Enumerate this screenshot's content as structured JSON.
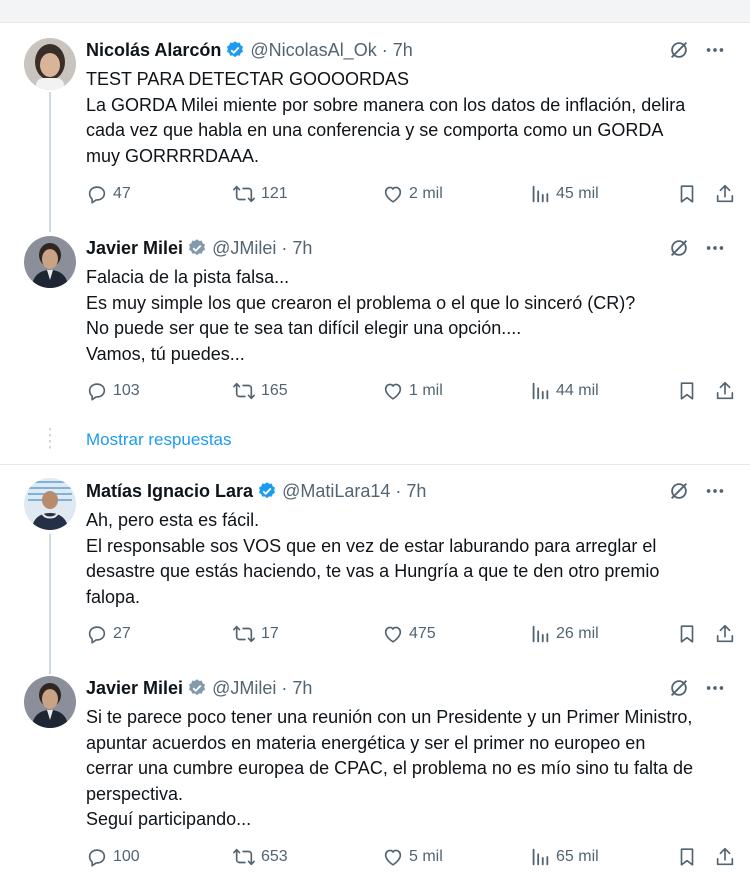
{
  "colors": {
    "accent": "#1d9bf0",
    "muted": "#536471",
    "text": "#0f1419",
    "verified": "#1d9bf0",
    "verified_gray": "#829aab"
  },
  "link": {
    "show_replies": "Mostrar respuestas"
  },
  "tweets": [
    {
      "name": "Nicolás Alarcón",
      "badge": "verified-blue",
      "handle": "@NicolasAl_Ok",
      "dot": "·",
      "time": "7h",
      "lines": [
        "TEST PARA DETECTAR GOOOORDAS",
        "La GORDA Milei miente por sobre manera con los datos de inflación, delira",
        "cada vez que habla en una conferencia y se comporta como un GORDA",
        "muy GORRRRDAAA."
      ],
      "stats": {
        "replies": "47",
        "retweets": "121",
        "likes": "2 mil",
        "views": "45 mil"
      }
    },
    {
      "name": "Javier Milei",
      "badge": "verified-gray",
      "handle": "@JMilei",
      "dot": "·",
      "time": "7h",
      "lines": [
        "Falacia de la pista falsa...",
        "Es muy simple los que crearon el problema o el que lo sinceró (CR)?",
        "No puede ser que te sea tan difícil elegir una opción....",
        "Vamos, tú puedes..."
      ],
      "stats": {
        "replies": "103",
        "retweets": "165",
        "likes": "1 mil",
        "views": "44 mil"
      }
    },
    {
      "name": "Matías Ignacio Lara",
      "badge": "verified-blue",
      "handle": "@MatiLara14",
      "dot": "·",
      "time": "7h",
      "lines": [
        "Ah, pero esta es fácil.",
        "El responsable sos VOS que en vez de estar laburando para arreglar el",
        "desastre que estás haciendo, te vas a Hungría a que te den otro premio",
        "falopa."
      ],
      "stats": {
        "replies": "27",
        "retweets": "17",
        "likes": "475",
        "views": "26 mil"
      }
    },
    {
      "name": "Javier Milei",
      "badge": "verified-gray",
      "handle": "@JMilei",
      "dot": "·",
      "time": "7h",
      "lines": [
        "Si te parece poco tener una reunión con un Presidente y un Primer Ministro,",
        "apuntar acuerdos en materia energética y ser el primer no europeo en",
        "cerrar una cumbre europea de CPAC, el problema no es mío sino tu falta de",
        "perspectiva.",
        "Seguí participando..."
      ],
      "stats": {
        "replies": "100",
        "retweets": "653",
        "likes": "5 mil",
        "views": "65 mil"
      }
    }
  ]
}
